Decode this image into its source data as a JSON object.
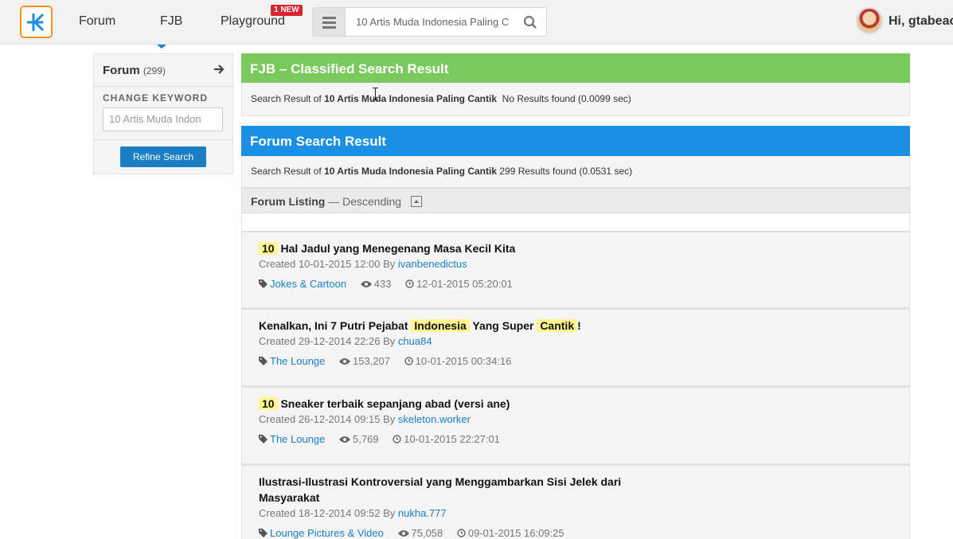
{
  "header": {
    "nav": [
      "Forum",
      "FJB",
      "Playground"
    ],
    "new_badge": "1 NEW",
    "search_value": "10 Artis Muda Indonesia Paling C",
    "greeting": "Hi, gtabeac"
  },
  "sidebar": {
    "forum_label": "Forum",
    "forum_count": "(299)",
    "change_keyword_label": "CHANGE KEYWORD",
    "keyword_value": "10 Artis Muda Indon",
    "refine_button": "Refine Search"
  },
  "fjb": {
    "title": "FJB – Classified Search Result",
    "result_prefix": "Search Result of",
    "keyword": "10 Artis Muda Indonesia Paling Cantik",
    "result_text": "No Results found (0.0099 sec)"
  },
  "forum": {
    "title": "Forum Search Result",
    "result_prefix": "Search Result of",
    "keyword": "10 Artis Muda Indonesia Paling Cantik",
    "result_text": "299 Results found (0.0531 sec)",
    "listing_title": "Forum Listing",
    "listing_order": "— Descending"
  },
  "threads": [
    {
      "title_parts": [
        {
          "t": "10",
          "hl": true
        },
        {
          "t": " Hal Jadul yang Menegenang Masa Kecil Kita",
          "hl": false
        }
      ],
      "created": "Created 10-01-2015 12:00 By",
      "author": "ivanbenedictus",
      "category": "Jokes & Cartoon",
      "views": "433",
      "last": "12-01-2015 05:20:01"
    },
    {
      "title_parts": [
        {
          "t": "Kenalkan, Ini 7 Putri Pejabat ",
          "hl": false
        },
        {
          "t": "Indonesia",
          "hl": true
        },
        {
          "t": " Yang Super ",
          "hl": false
        },
        {
          "t": "Cantik",
          "hl": true
        },
        {
          "t": "!",
          "hl": false
        }
      ],
      "created": "Created 29-12-2014 22:26 By",
      "author": "chua84",
      "category": "The Lounge",
      "views": "153,207",
      "last": "10-01-2015 00:34:16"
    },
    {
      "title_parts": [
        {
          "t": "10",
          "hl": true
        },
        {
          "t": " Sneaker terbaik sepanjang abad (versi ane)",
          "hl": false
        }
      ],
      "created": "Created 26-12-2014 09:15 By",
      "author": "skeleton.worker",
      "category": "The Lounge",
      "views": "5,769",
      "last": "10-01-2015 22:27:01"
    },
    {
      "title_parts": [
        {
          "t": "Ilustrasi-Ilustrasi Kontroversial yang Menggambarkan Sisi Jelek dari Masyarakat",
          "hl": false
        }
      ],
      "created": "Created 18-12-2014 09:52 By",
      "author": "nukha.777",
      "category": "Lounge Pictures & Video",
      "views": "75,058",
      "last": "09-01-2015 16:09:25"
    }
  ]
}
